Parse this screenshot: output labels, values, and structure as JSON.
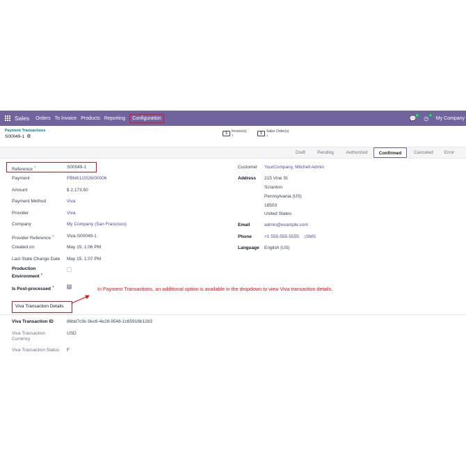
{
  "navbar": {
    "brand": "Sales",
    "menu": [
      "Orders",
      "To Invoice",
      "Products",
      "Reporting",
      "Configuration"
    ],
    "chat_badge": "6",
    "activity_badge": "9",
    "company": "My Company"
  },
  "breadcrumb": {
    "parent": "Payment Transactions",
    "record": "S00049-1"
  },
  "smart_buttons": {
    "invoice_label": "Invoice(s)",
    "invoice_count": "1",
    "sales_label": "Sales Order(s)",
    "sales_count": "1"
  },
  "statusbar": {
    "stages": [
      "Draft",
      "Pending",
      "Authorized",
      "Confirmed",
      "Canceled",
      "Error"
    ],
    "active": "Confirmed"
  },
  "left_fields": {
    "reference_label": "Reference",
    "reference_value": "S00049-1",
    "payment_label": "Payment",
    "payment_value": "PBNK1/2026/00006",
    "amount_label": "Amount",
    "amount_value": "$ 2,173.50",
    "method_label": "Payment Method",
    "method_value": "Viva",
    "provider_label": "Provider",
    "provider_value": "Viva",
    "company_label": "Company",
    "company_value": "My Company (San Francisco)",
    "provider_ref_label": "Provider Reference",
    "provider_ref_value": "Viva-S00049-1",
    "created_label": "Created on",
    "created_value": "May 15, 1:06 PM",
    "last_change_label": "Last State Change Date",
    "last_change_value": "May 15, 1:07 PM",
    "production_label_1": "Production",
    "production_label_2": "Environment",
    "production_checked": false,
    "post_processed_label": "Is Post-processed",
    "post_processed_checked": true
  },
  "right_fields": {
    "customer_label": "Customer",
    "customer_value": "YourCompany, Mitchell Admin",
    "address_label": "Address",
    "address_lines": [
      "215 Vine St",
      "Scranton",
      "Pennsylvania (US)",
      "18503",
      "United States"
    ],
    "email_label": "Email",
    "email_value": "admin@example.com",
    "phone_label": "Phone",
    "phone_value": "+1 555-555-5555",
    "sms_label": "SMS",
    "language_label": "Language",
    "language_value": "English (US)"
  },
  "annotation": "In Payment Transactions, an additional option is available in the dropdown to view Viva transaction details.",
  "viva_tab": {
    "title": "Viva Transaction Details",
    "id_label": "Viva Transaction ID",
    "id_value": "86bd7c9c-9ec6-4e28-9548-1c65916b1283",
    "currency_label_1": "Viva Transaction",
    "currency_label_2": "Currency",
    "currency_value": "USD",
    "status_label": "Viva Transaction Status",
    "status_value": "F"
  },
  "colors": {
    "navbar": "#71639e",
    "annotation_red": "#e0111a",
    "link": "#4f46a8",
    "teal": "#017e84"
  }
}
